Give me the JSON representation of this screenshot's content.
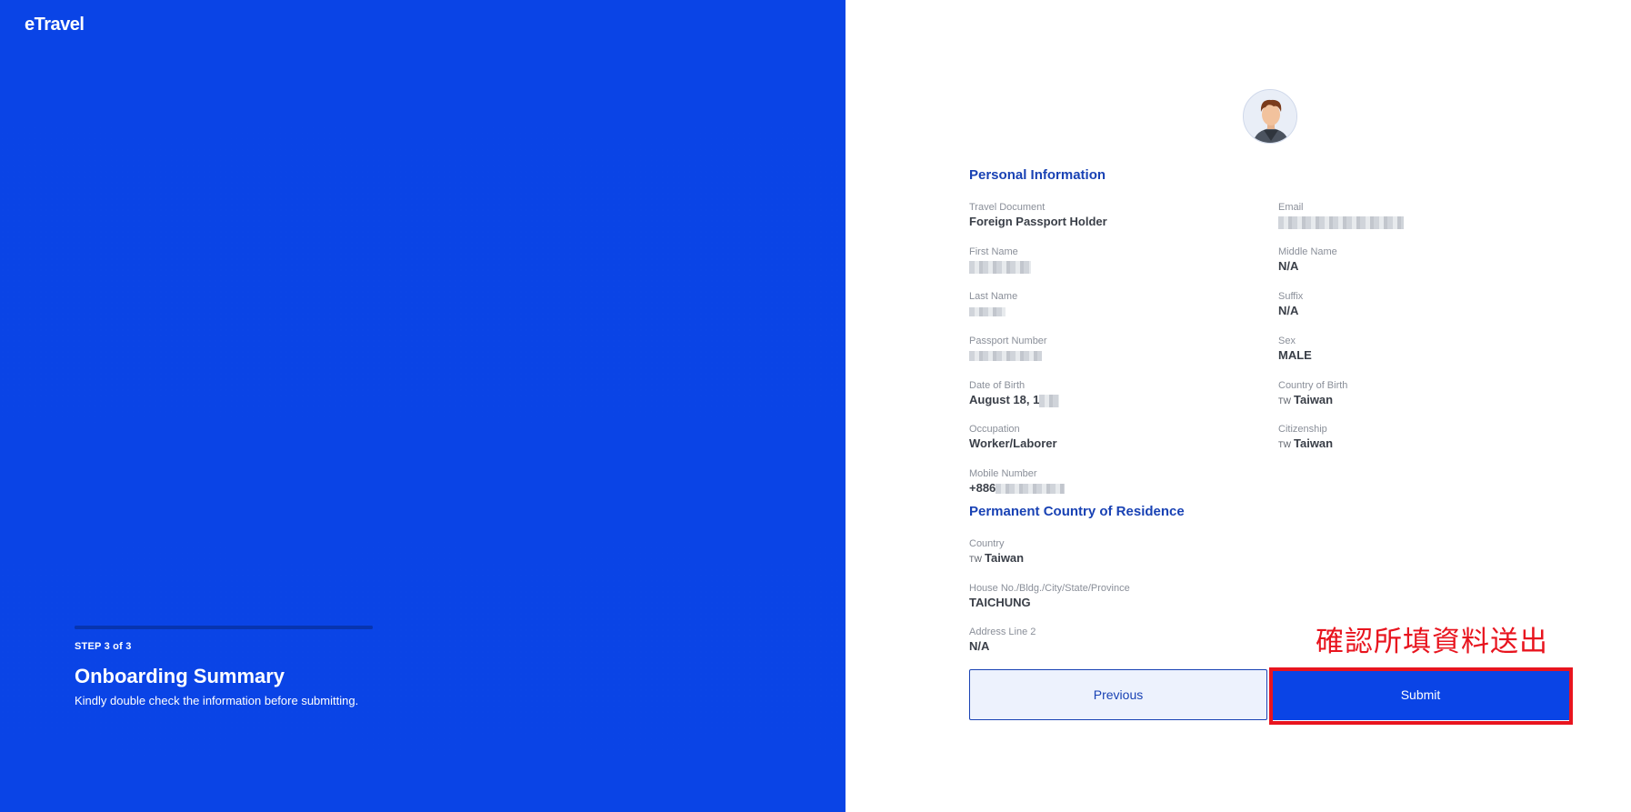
{
  "brand": {
    "logo_text": "eTravel"
  },
  "step": {
    "label": "STEP 3 of 3",
    "progress": 1.0,
    "title": "Onboarding Summary",
    "subtitle": "Kindly double check the information before submitting."
  },
  "personal": {
    "section_title": "Personal Information",
    "travel_document": {
      "label": "Travel Document",
      "value": "Foreign Passport Holder"
    },
    "email": {
      "label": "Email",
      "value": ""
    },
    "first_name": {
      "label": "First Name",
      "value": ""
    },
    "middle_name": {
      "label": "Middle Name",
      "value": "N/A"
    },
    "last_name": {
      "label": "Last Name",
      "value": ""
    },
    "suffix": {
      "label": "Suffix",
      "value": "N/A"
    },
    "passport_number": {
      "label": "Passport Number",
      "value": ""
    },
    "sex": {
      "label": "Sex",
      "value": "MALE"
    },
    "date_of_birth": {
      "label": "Date of Birth",
      "value": "August 18, 1"
    },
    "country_of_birth": {
      "label": "Country of Birth",
      "code": "TW",
      "value": "Taiwan"
    },
    "occupation": {
      "label": "Occupation",
      "value": "Worker/Laborer"
    },
    "citizenship": {
      "label": "Citizenship",
      "code": "TW",
      "value": "Taiwan"
    },
    "mobile_number": {
      "label": "Mobile Number",
      "value": "+886"
    }
  },
  "residence": {
    "section_title": "Permanent Country of Residence",
    "country": {
      "label": "Country",
      "code": "TW",
      "value": "Taiwan"
    },
    "address1": {
      "label": "House No./Bldg./City/State/Province",
      "value": "TAICHUNG"
    },
    "address2": {
      "label": "Address Line 2",
      "value": "N/A"
    }
  },
  "buttons": {
    "previous": "Previous",
    "submit": "Submit"
  },
  "annotation": {
    "text": "確認所填資料送出",
    "color": "#e8141e"
  },
  "colors": {
    "brand_blue": "#0a44e6",
    "heading_blue": "#1942b4"
  }
}
